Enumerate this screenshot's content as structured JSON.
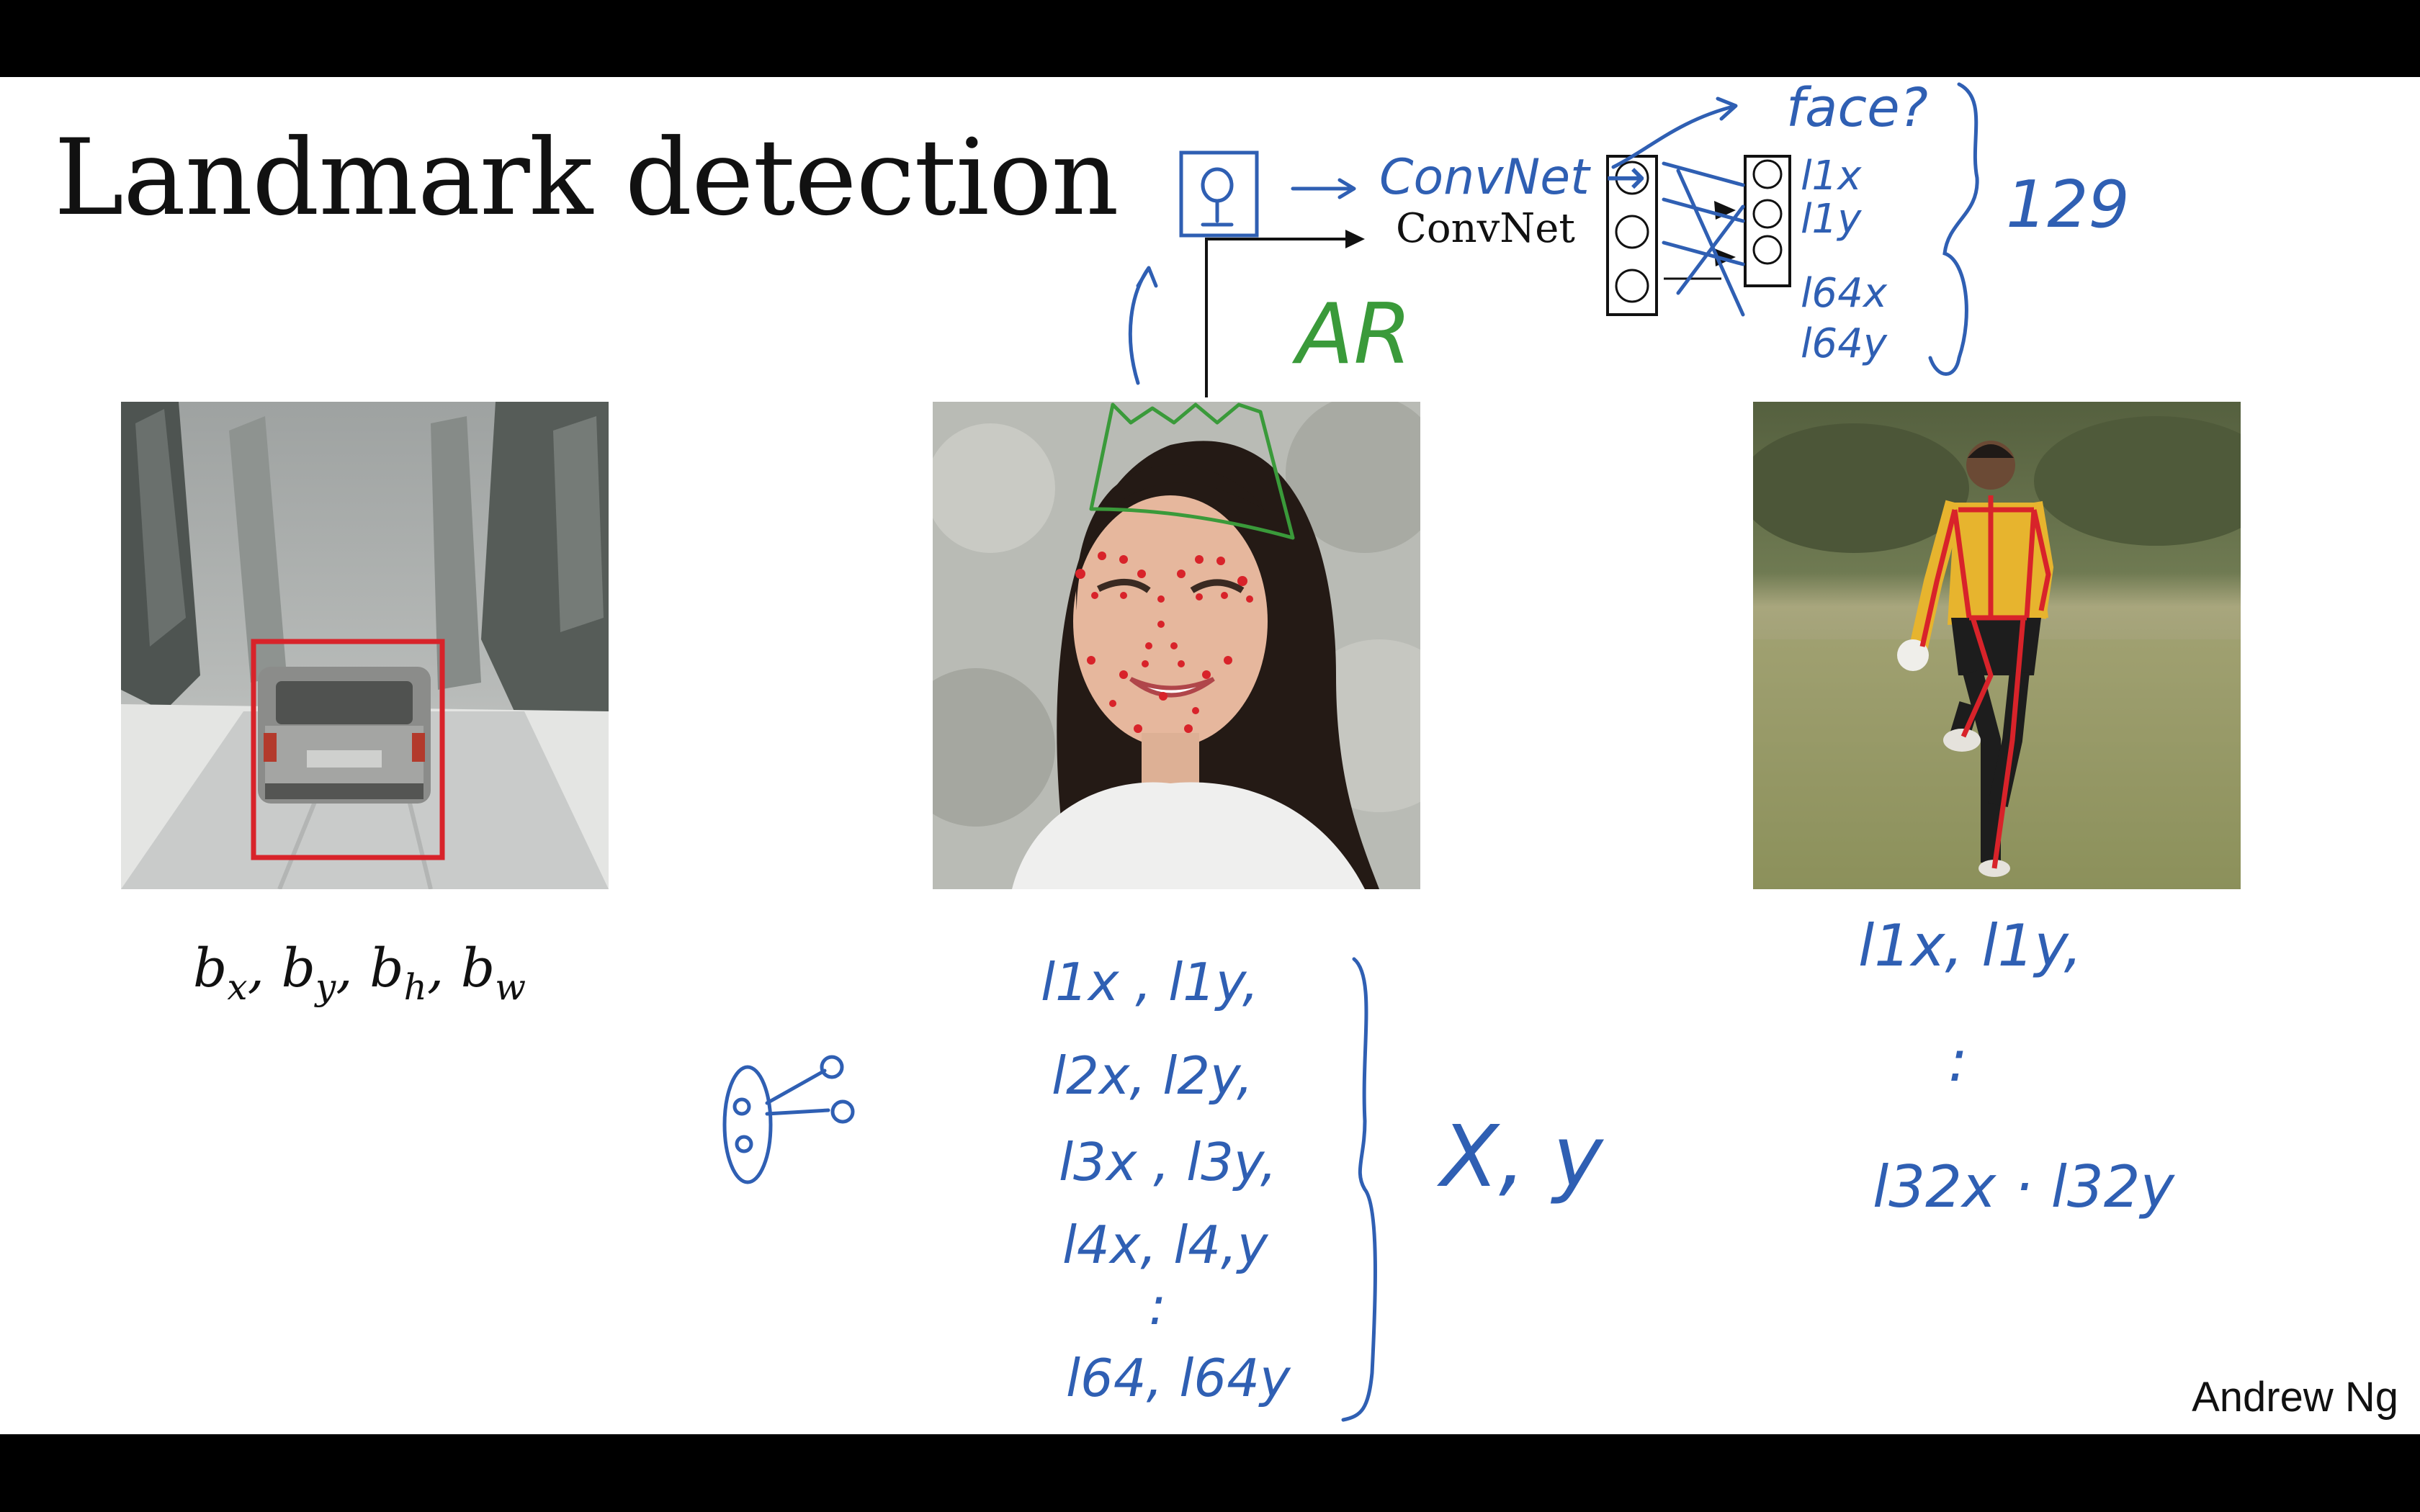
{
  "slide": {
    "title": "Landmark detection",
    "author": "Andrew Ng",
    "bbox_label": {
      "b": "b",
      "x": "x",
      "y": "y",
      "h": "h",
      "w": "w",
      "sep": ", "
    },
    "convnet_label": "ConvNet"
  },
  "photos": [
    {
      "name": "car-photo",
      "subject": "car on snowy road with red bounding box"
    },
    {
      "name": "face-photo",
      "subject": "smiling woman with red facial landmark dots"
    },
    {
      "name": "player-photo",
      "subject": "soccer player with red pose skeleton"
    }
  ],
  "annotations": {
    "face_query": "face?",
    "convnet_handwritten": "ConvNet →",
    "outputs": [
      "l1x",
      "l1y",
      "l64x",
      "l64y"
    ],
    "count": "129",
    "ar": "AR",
    "face_landmarks": [
      "l1x , l1y,",
      "l2x, l2y,",
      "l3x , l3y,",
      "l4x, l4,y",
      ":",
      "l64, l64y"
    ],
    "xy": "X, y",
    "pose_landmarks": [
      "l1x, l1y,",
      ":",
      "l32x · l32y"
    ]
  },
  "colors": {
    "ink_blue": "#2f5fb3",
    "ink_green": "#3a9a3a",
    "mark_red": "#d8232a",
    "letterbox": "#000000"
  }
}
